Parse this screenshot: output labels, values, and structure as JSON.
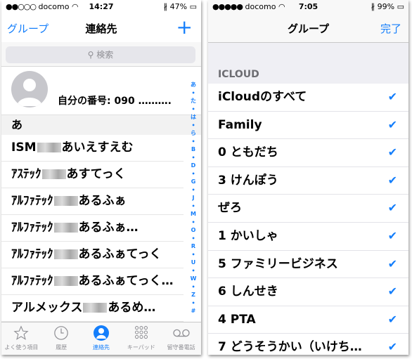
{
  "left": {
    "status": {
      "carrier": "docomo",
      "time": "14:27",
      "battery": "47%"
    },
    "nav": {
      "left": "グループ",
      "title": "連絡先",
      "add_icon": "plus"
    },
    "search": {
      "placeholder": "検索"
    },
    "my_card": {
      "label": "自分の番号:",
      "number": "090 ………."
    },
    "section": "あ",
    "contacts": [
      {
        "prefix": "ISM",
        "suffix": "あいえすえむ"
      },
      {
        "prefix": "ｱｽﾃｯｸ",
        "suffix": "あすてっく"
      },
      {
        "prefix": "ｱﾙﾌｧﾃｯｸ",
        "suffix": "あるふぁ"
      },
      {
        "prefix": "ｱﾙﾌｧﾃｯｸ",
        "suffix": "あるふぁ…"
      },
      {
        "prefix": "ｱﾙﾌｧﾃｯｸ",
        "suffix": "あるふぁてっく"
      },
      {
        "prefix": "ｱﾙﾌｧﾃｯｸ",
        "suffix": "あるふぁてっく…"
      },
      {
        "prefix": "アルメックス",
        "suffix": "あるめ…"
      }
    ],
    "index": [
      "あ",
      "た",
      "は",
      "ら",
      "B",
      "D",
      "G",
      "J",
      "M",
      "O",
      "R",
      "U",
      "W",
      "Z",
      "#"
    ],
    "tabs": [
      {
        "label": "よく使う項目",
        "icon": "star-icon"
      },
      {
        "label": "履歴",
        "icon": "clock-icon"
      },
      {
        "label": "連絡先",
        "icon": "contact-icon",
        "active": true
      },
      {
        "label": "キーパッド",
        "icon": "keypad-icon"
      },
      {
        "label": "留守番電話",
        "icon": "voicemail-icon"
      }
    ]
  },
  "right": {
    "status": {
      "carrier": "docomo",
      "time": "7:05",
      "battery": "99%"
    },
    "nav": {
      "title": "グループ",
      "done": "完了"
    },
    "group_header": "ICLOUD",
    "groups": [
      "iCloudのすべて",
      "Family",
      "0 ともだち",
      "3 けんぽう",
      "ぜろ",
      "1 かいしゃ",
      "5 ファミリービジネス",
      "6 しんせき",
      "4 PTA",
      "7 どうそうかい（いけち…"
    ]
  },
  "colors": {
    "accent": "#147efb",
    "gray": "#8e8e93"
  }
}
